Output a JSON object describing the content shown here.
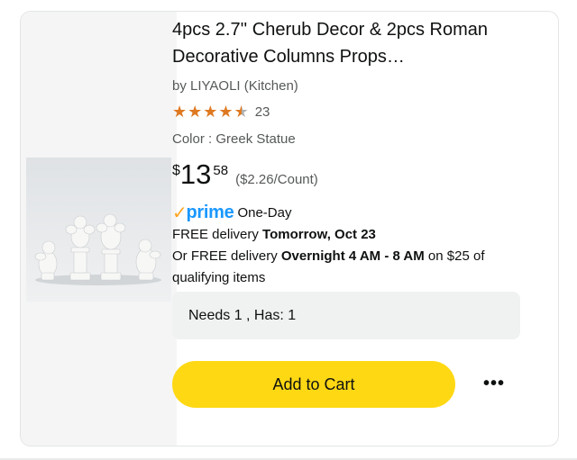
{
  "product": {
    "title": "4pcs 2.7'' Cherub Decor & 2pcs Roman Decorative Columns Props…",
    "brand": "by LIYAOLI (Kitchen)",
    "rating": {
      "stars": 4.5,
      "count": "23"
    },
    "color": "Color : Greek Statue",
    "price": {
      "currency": "$",
      "dollars": "13",
      "cents": "58",
      "unit_price": "($2.26/Count)"
    },
    "prime": {
      "check": "✓",
      "logo": "prime",
      "speed": "One-Day"
    },
    "delivery": {
      "line1_prefix": "FREE delivery ",
      "line1_bold": "Tomorrow, Oct 23",
      "line2_prefix": "Or FREE delivery ",
      "line2_bold": "Overnight 4 AM - 8 AM",
      "line2_suffix": " on $25 of qualifying items"
    },
    "image_alt_icon": "product-image"
  },
  "needs": {
    "text": "Needs 1 , Has: 1"
  },
  "actions": {
    "add_to_cart": "Add to Cart",
    "more": "•••"
  },
  "colors": {
    "accent_star": "#de7921",
    "prime_blue": "#1a98ff",
    "prime_check": "#ffa41c",
    "cart_yellow": "#ffd814"
  }
}
